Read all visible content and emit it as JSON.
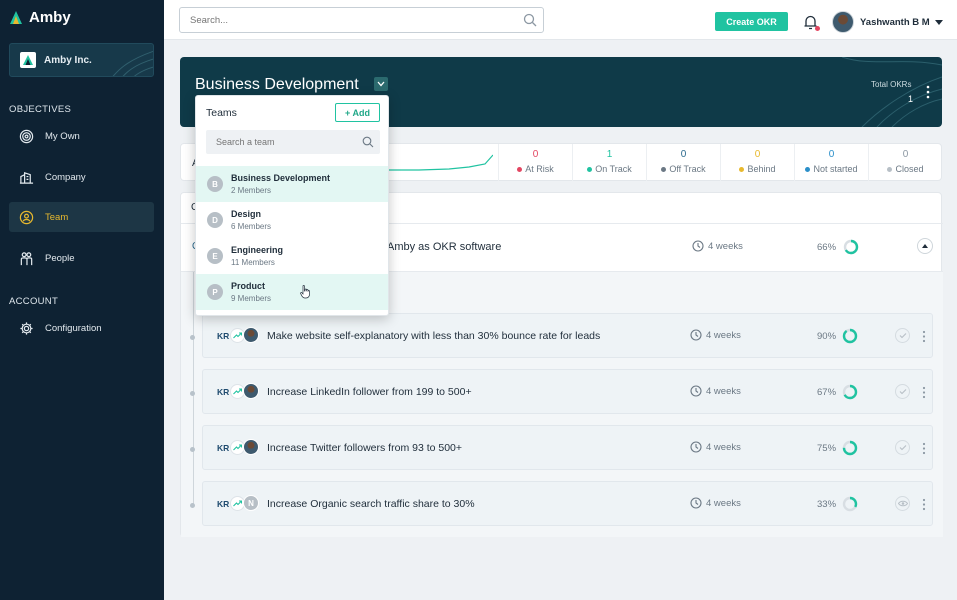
{
  "colors": {
    "sidebar_bg": "#0e2233",
    "accent": "#20c3a1",
    "active_nav": "#e8b92e",
    "banner_bg": "#0f3a48",
    "at_risk": "#e34661",
    "on_track": "#20c3a1",
    "off_track": "#6b7884",
    "behind": "#e8b92e",
    "not_started": "#2b8fc9",
    "closed": "#b7bfc6"
  },
  "sidebar": {
    "brand": "Amby",
    "org_name": "Amby Inc.",
    "objectives_label": "OBJECTIVES",
    "items": [
      {
        "label": "My Own",
        "icon": "target-icon",
        "active": false
      },
      {
        "label": "Company",
        "icon": "company-icon",
        "active": false
      },
      {
        "label": "Team",
        "icon": "team-icon",
        "active": true
      },
      {
        "label": "People",
        "icon": "people-icon",
        "active": false
      }
    ],
    "account_label": "ACCOUNT",
    "account_items": [
      {
        "label": "Configuration",
        "icon": "gear-icon"
      }
    ]
  },
  "topbar": {
    "search_placeholder": "Search...",
    "create_button": "Create OKR",
    "user_name": "Yashwanth B M"
  },
  "banner": {
    "title": "Business Development",
    "total_label": "Total OKRs",
    "total_count": "1"
  },
  "stats": {
    "leading_text": "A",
    "items": [
      {
        "value": "0",
        "label": "At Risk",
        "color": "#e34661"
      },
      {
        "value": "1",
        "label": "On Track",
        "color": "#20c3a1"
      },
      {
        "value": "0",
        "label": "Off Track",
        "color": "#6b7884"
      },
      {
        "value": "0",
        "label": "Behind",
        "color": "#e8b92e"
      },
      {
        "value": "0",
        "label": "Not started",
        "color": "#2b8fc9"
      },
      {
        "value": "0",
        "label": "Closed",
        "color": "#b7bfc6"
      }
    ]
  },
  "objective": {
    "header_letter": "C",
    "prefix": "O",
    "title": "Amby as OKR software",
    "duration": "4 weeks",
    "progress": "66%",
    "progress_value": 0.66
  },
  "key_results": [
    {
      "badge": "KR",
      "owner": "photo",
      "title": "Make website self-explanatory with less than 30% bounce rate for leads",
      "duration": "4 weeks",
      "progress": "90%",
      "progress_value": 0.9,
      "action": "check-icon"
    },
    {
      "badge": "KR",
      "owner": "photo",
      "title": "Increase LinkedIn follower from 199 to 500+",
      "duration": "4 weeks",
      "progress": "67%",
      "progress_value": 0.67,
      "action": "check-icon"
    },
    {
      "badge": "KR",
      "owner": "photo",
      "title": "Increase Twitter followers from 93 to 500+",
      "duration": "4 weeks",
      "progress": "75%",
      "progress_value": 0.75,
      "action": "check-icon"
    },
    {
      "badge": "KR",
      "owner": "N",
      "title": "Increase Organic search traffic share to 30%",
      "duration": "4 weeks",
      "progress": "33%",
      "progress_value": 0.33,
      "action": "eye-icon"
    }
  ],
  "dropdown": {
    "title": "Teams",
    "add_button": "+ Add",
    "search_placeholder": "Search a team",
    "teams": [
      {
        "initial": "B",
        "name": "Business Development",
        "members": "2 Members",
        "state": "selected"
      },
      {
        "initial": "D",
        "name": "Design",
        "members": "6 Members",
        "state": ""
      },
      {
        "initial": "E",
        "name": "Engineering",
        "members": "11 Members",
        "state": ""
      },
      {
        "initial": "P",
        "name": "Product",
        "members": "9 Members",
        "state": "hover"
      }
    ]
  }
}
